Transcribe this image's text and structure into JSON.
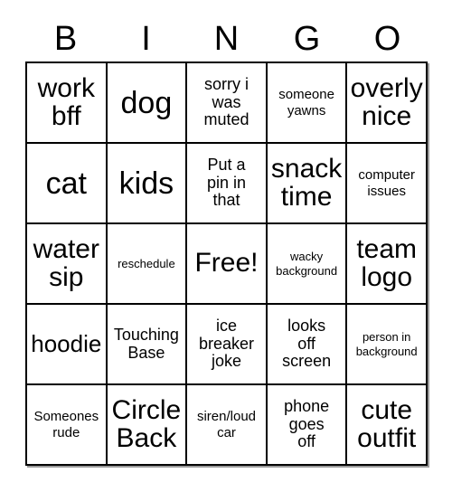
{
  "card": {
    "header_letters": [
      "B",
      "I",
      "N",
      "G",
      "O"
    ],
    "rows": [
      [
        {
          "text": "work\nbff",
          "size": "xxl"
        },
        {
          "text": "dog",
          "size": "huge"
        },
        {
          "text": "sorry i\nwas\nmuted",
          "size": "md"
        },
        {
          "text": "someone\nyawns",
          "size": "sm"
        },
        {
          "text": "overly\nnice",
          "size": "xxl"
        }
      ],
      [
        {
          "text": "cat",
          "size": "huge"
        },
        {
          "text": "kids",
          "size": "huge"
        },
        {
          "text": "Put a\npin in\nthat",
          "size": "md"
        },
        {
          "text": "snack\ntime",
          "size": "xxl"
        },
        {
          "text": "computer\nissues",
          "size": "sm"
        }
      ],
      [
        {
          "text": "water\nsip",
          "size": "xxl"
        },
        {
          "text": "reschedule",
          "size": "xs"
        },
        {
          "text": "Free!",
          "size": "xxl"
        },
        {
          "text": "wacky\nbackground",
          "size": "xs"
        },
        {
          "text": "team\nlogo",
          "size": "xxl"
        }
      ],
      [
        {
          "text": "hoodie",
          "size": "xl"
        },
        {
          "text": "Touching\nBase",
          "size": "md"
        },
        {
          "text": "ice\nbreaker\njoke",
          "size": "md"
        },
        {
          "text": "looks\noff\nscreen",
          "size": "md"
        },
        {
          "text": "person in\nbackground",
          "size": "xs"
        }
      ],
      [
        {
          "text": "Someones\nrude",
          "size": "sm"
        },
        {
          "text": "Circle\nBack",
          "size": "xxl"
        },
        {
          "text": "siren/loud\ncar",
          "size": "sm"
        },
        {
          "text": "phone\ngoes\noff",
          "size": "md"
        },
        {
          "text": "cute\noutfit",
          "size": "xxl"
        }
      ]
    ]
  },
  "colors": {
    "background": "#ffffff",
    "grid_line": "#000000",
    "text": "#000000",
    "shadow": "#9a9a9a"
  }
}
